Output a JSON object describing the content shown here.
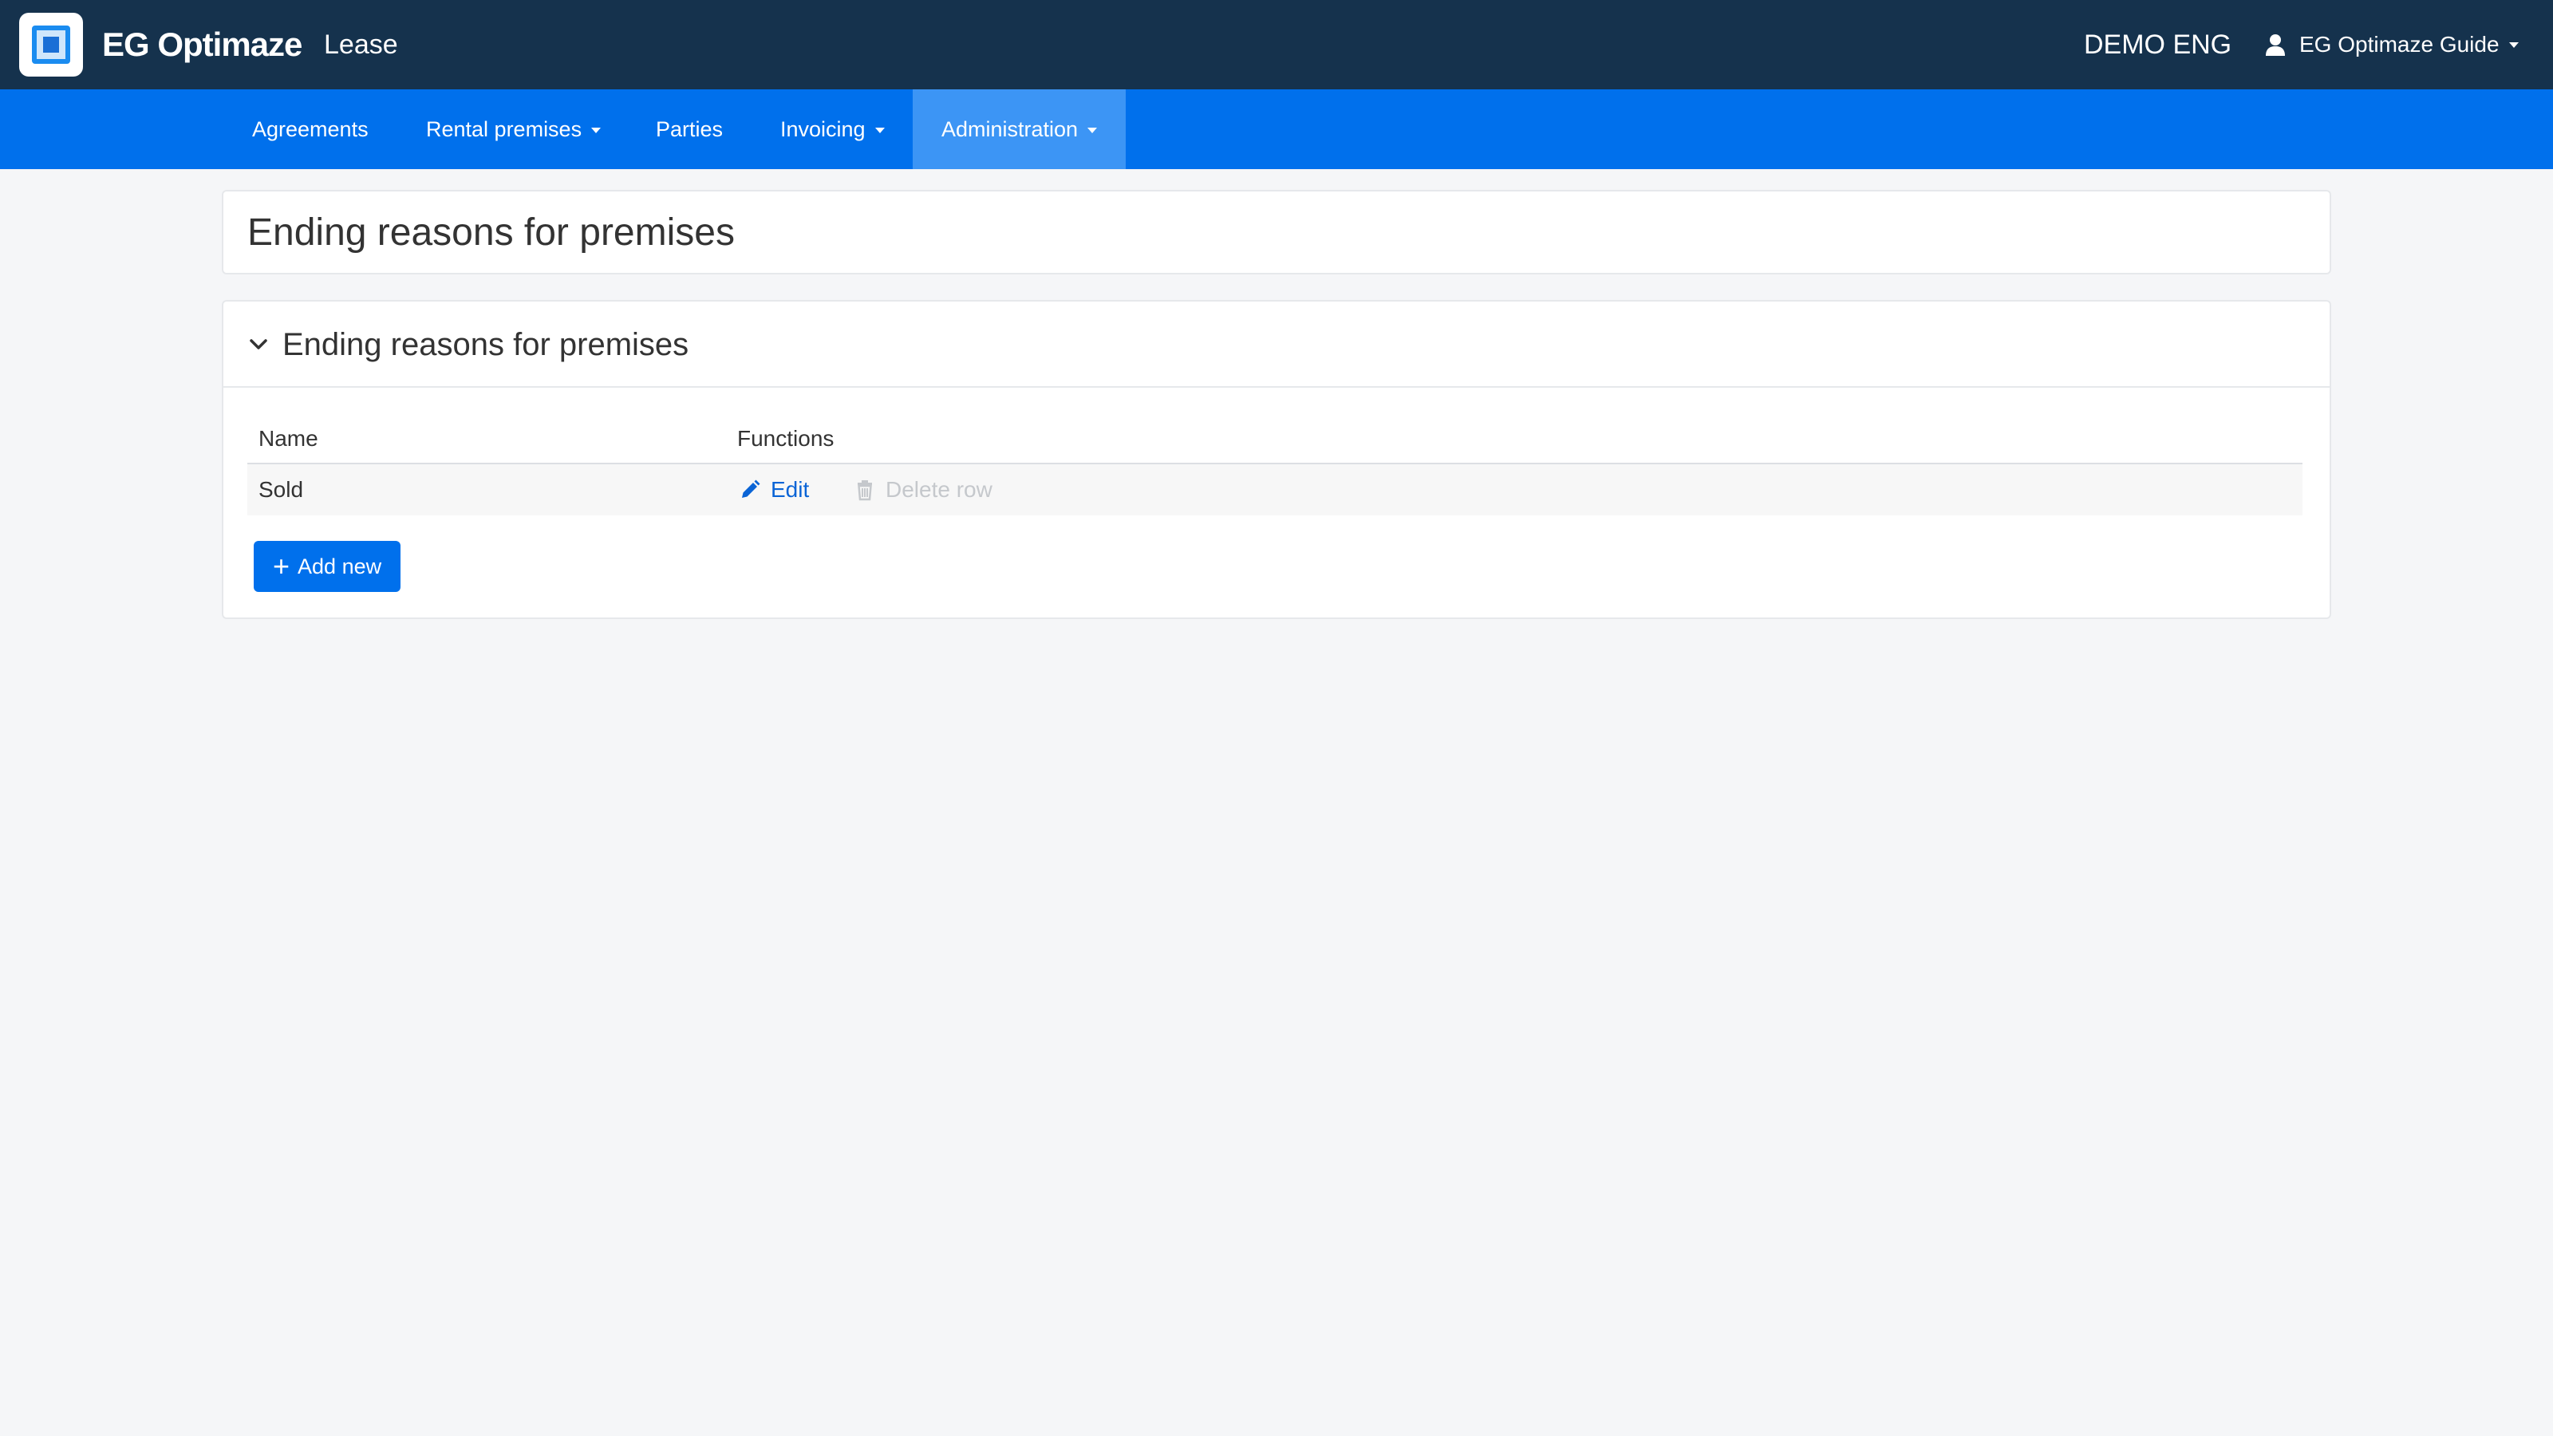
{
  "header": {
    "brand": "EG Optimaze",
    "module": "Lease",
    "tenant": "DEMO ENG",
    "user": "EG Optimaze Guide"
  },
  "nav": {
    "items": [
      {
        "label": "Agreements"
      },
      {
        "label": "Rental premises"
      },
      {
        "label": "Parties"
      },
      {
        "label": "Invoicing"
      },
      {
        "label": "Administration"
      }
    ]
  },
  "page": {
    "title": "Ending reasons for premises"
  },
  "section": {
    "title": "Ending reasons for premises",
    "columns": [
      "Name",
      "Functions"
    ],
    "rows": [
      {
        "name": "Sold",
        "edit": "Edit",
        "delete": "Delete row"
      }
    ],
    "add_label": "Add new"
  },
  "colors": {
    "topbar": "#15324d",
    "navbar": "#0070ec",
    "nav_active": "#3c95f5",
    "link": "#0a64d6",
    "disabled": "#c5c8cc"
  }
}
